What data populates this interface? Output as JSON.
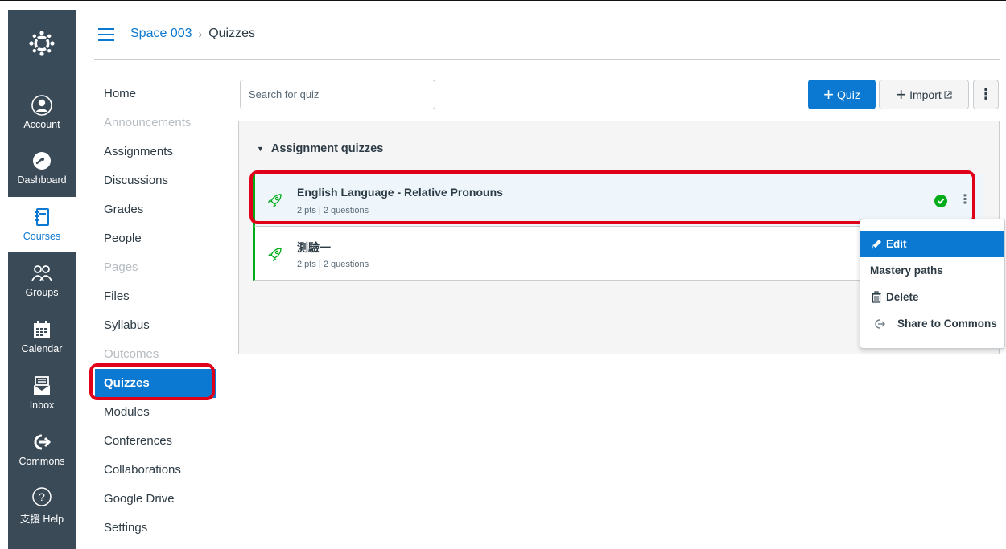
{
  "global_nav": {
    "items": [
      {
        "label": "Account",
        "icon": "account-icon"
      },
      {
        "label": "Dashboard",
        "icon": "dashboard-icon"
      },
      {
        "label": "Courses",
        "icon": "courses-icon"
      },
      {
        "label": "Groups",
        "icon": "groups-icon"
      },
      {
        "label": "Calendar",
        "icon": "calendar-icon"
      },
      {
        "label": "Inbox",
        "icon": "inbox-icon"
      },
      {
        "label": "Commons",
        "icon": "commons-icon"
      },
      {
        "label": "支援 Help",
        "icon": "help-icon"
      }
    ],
    "active": "Courses"
  },
  "breadcrumb": {
    "course": "Space 003",
    "separator": "›",
    "page": "Quizzes"
  },
  "course_nav": {
    "items": [
      {
        "label": "Home",
        "state": "enabled"
      },
      {
        "label": "Announcements",
        "state": "disabled"
      },
      {
        "label": "Assignments",
        "state": "enabled"
      },
      {
        "label": "Discussions",
        "state": "enabled"
      },
      {
        "label": "Grades",
        "state": "enabled"
      },
      {
        "label": "People",
        "state": "enabled"
      },
      {
        "label": "Pages",
        "state": "disabled"
      },
      {
        "label": "Files",
        "state": "enabled"
      },
      {
        "label": "Syllabus",
        "state": "enabled"
      },
      {
        "label": "Outcomes",
        "state": "disabled"
      },
      {
        "label": "Quizzes",
        "state": "active"
      },
      {
        "label": "Modules",
        "state": "enabled"
      },
      {
        "label": "Conferences",
        "state": "enabled"
      },
      {
        "label": "Collaborations",
        "state": "enabled"
      },
      {
        "label": "Google Drive",
        "state": "enabled"
      },
      {
        "label": "Settings",
        "state": "enabled"
      }
    ]
  },
  "toolbar": {
    "search_placeholder": "Search for quiz",
    "add_quiz_plus": "+",
    "add_quiz_label": "Quiz",
    "import_plus": "+",
    "import_label": "Import",
    "more_label": "⋮"
  },
  "quiz_group": {
    "title": "Assignment quizzes",
    "toggle": "▼",
    "quizzes": [
      {
        "title": "English Language - Relative Pronouns",
        "meta": "2 pts | 2 questions",
        "published": true
      },
      {
        "title": "測驗一",
        "meta": "2 pts | 2 questions",
        "published": false
      }
    ],
    "kebab": "⋮"
  },
  "context_menu": {
    "items": [
      {
        "label": "Edit",
        "icon": "pencil-icon"
      },
      {
        "label": "Mastery paths",
        "icon": ""
      },
      {
        "label": "Delete",
        "icon": "trash-icon"
      },
      {
        "label": "Share to Commons",
        "icon": "commons-share-icon"
      }
    ],
    "active": "Edit"
  },
  "colors": {
    "nav_bg": "#3b4a57",
    "accent": "#0b78d1",
    "published": "#00ac18",
    "highlight_box": "#e0001a"
  }
}
